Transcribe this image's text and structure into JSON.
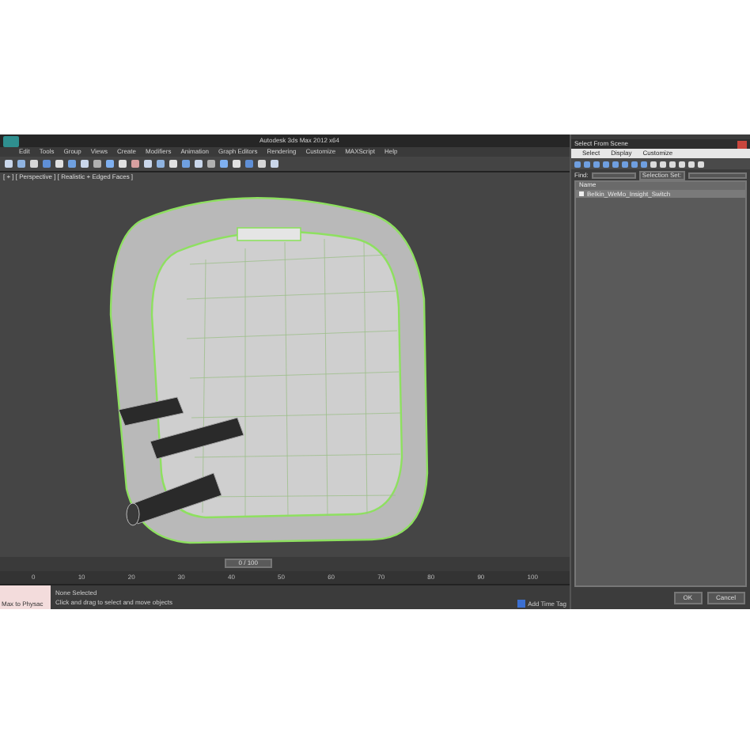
{
  "window": {
    "title": "Autodesk 3ds Max 2012 x64"
  },
  "menu": [
    "Edit",
    "Tools",
    "Group",
    "Views",
    "Create",
    "Modifiers",
    "Animation",
    "Graph Editors",
    "Rendering",
    "Customize",
    "MAXScript",
    "Help"
  ],
  "viewport": {
    "label": "[ + ] [ Perspective ] [ Realistic + Edged Faces ]"
  },
  "time_slider": {
    "position": "0 / 100",
    "level": 0.43
  },
  "ruler_ticks": [
    "0",
    "10",
    "20",
    "30",
    "40",
    "50",
    "60",
    "70",
    "80",
    "90",
    "100"
  ],
  "status": {
    "script_box": "Max to Physac",
    "selection": "None Selected",
    "prompt": "Click and drag to select and move objects",
    "time_tag": "Add Time Tag"
  },
  "dialog": {
    "title": "Select From Scene",
    "tabs": [
      {
        "label": "Select",
        "selected": false
      },
      {
        "label": "Display",
        "selected": false
      },
      {
        "label": "Customize",
        "selected": false
      }
    ],
    "find_label": "Find:",
    "selection_set_label": "Selection Set:",
    "column": "Name",
    "rows": [
      {
        "name": "Belkin_WeMo_Insight_Switch",
        "selected": true
      }
    ],
    "buttons": [
      "OK",
      "Cancel"
    ]
  }
}
